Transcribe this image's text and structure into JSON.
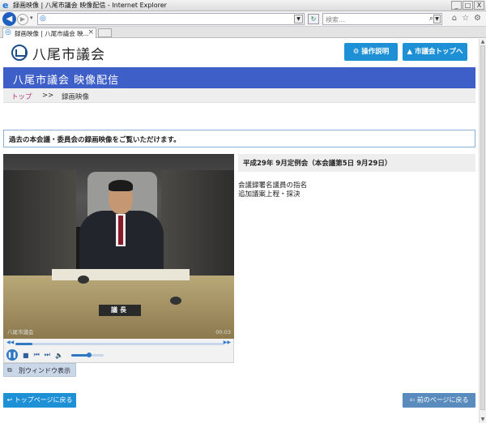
{
  "browser": {
    "window_title": "録画映像 | 八尾市議会 映像配信 - Internet Explorer",
    "search_placeholder": "検索...",
    "tab_label": "録画映像 | 八尾市議会 映...",
    "window_buttons": [
      "_",
      "□",
      "X"
    ]
  },
  "site": {
    "logo_text": "八尾市議会",
    "help_button": "操作説明",
    "top_button": "市議会トップへ",
    "header_title": "八尾市議会 映像配信"
  },
  "breadcrumb": {
    "top": "トップ",
    "separator": ">>",
    "current": "録画映像"
  },
  "notice": "過去の本会議・委員会の録画映像をご覧いただけます。",
  "video": {
    "name_plate": "議長",
    "watermark": "八尾市議会",
    "timecode": "00:03",
    "progress_fraction": 0.08,
    "volume_fraction": 0.55
  },
  "popout_button": "別ウィンドウ表示",
  "meeting": {
    "title": "平成29年 9月定例会（本会議第5日 9月29日）",
    "agenda": [
      "会議録署名議員の指名",
      "追加議案上程・採決"
    ]
  },
  "footer": {
    "back_to_top": "トップページに戻る",
    "back_to_prev": "前のページに戻る"
  },
  "colors": {
    "accent": "#1e90d6",
    "header_band": "#3f5fc8",
    "breadcrumb_link": "#b0356f"
  }
}
